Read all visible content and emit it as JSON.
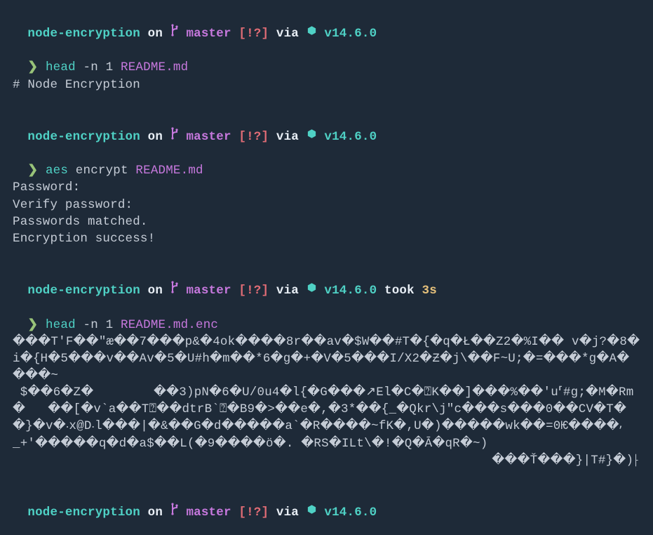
{
  "colors": {
    "bg": "#1e2a38",
    "cyan": "#4fd1c5",
    "magenta": "#c678dd",
    "red": "#e06c75",
    "yellow": "#e5c07b",
    "green_hex": "#4fd1c5",
    "text": "#d8dee9"
  },
  "prompt": {
    "dir": "node-encryption",
    "on": "on",
    "branch": "master",
    "status": "[!?]",
    "via": "via",
    "node_version": "v14.6.0",
    "took": "took",
    "duration": "3s",
    "arrow": "❯"
  },
  "blocks": [
    {
      "command": {
        "cmd": "head",
        "args": "-n 1",
        "file": "README.md"
      },
      "output": [
        "# Node Encryption"
      ]
    },
    {
      "command": {
        "cmd": "aes",
        "args": "encrypt",
        "file": "README.md"
      },
      "output": [
        "Password:",
        "Verify password:",
        "Passwords matched.",
        "Encryption success!"
      ]
    },
    {
      "show_took": true,
      "command": {
        "cmd": "head",
        "args": "-n 1",
        "file": "README.md.enc"
      },
      "output": [
        "���T'F��\"æ��7���p&�4ok����8r��av�$W��#T�{�q�Ł��Z2�%I�� v�j?�8�i�{H�5���v��Av�5�U#h�m��*6�g�+�V�5���I/X2�Ƶ�j\\��F~U;�=���*g�A� ���~",
        " $��6�Z�        ��3)pN�6�U/0u4�l{�G���↗El�C�⍰K��]���%��'u⸢#g;�M�Rm�   ��[�v`a��T⍰��dtrB`⍰�B9�>��e�,�3*��{_�Qkr\\j\"c���s���0��CV�T��}�v�⸳x@D⸳l���|�&��G�d�����a`�R����~fK�,U�)�����wk��=0Ѥ����⸴",
        "_+'�����q�d�a$��L(�9����ö�. �RS�ILt\\�!�Q�Ā�qR�~)"
      ],
      "output_right": "���Ť���}|T#}�)⸠"
    },
    {
      "command": null
    }
  ]
}
